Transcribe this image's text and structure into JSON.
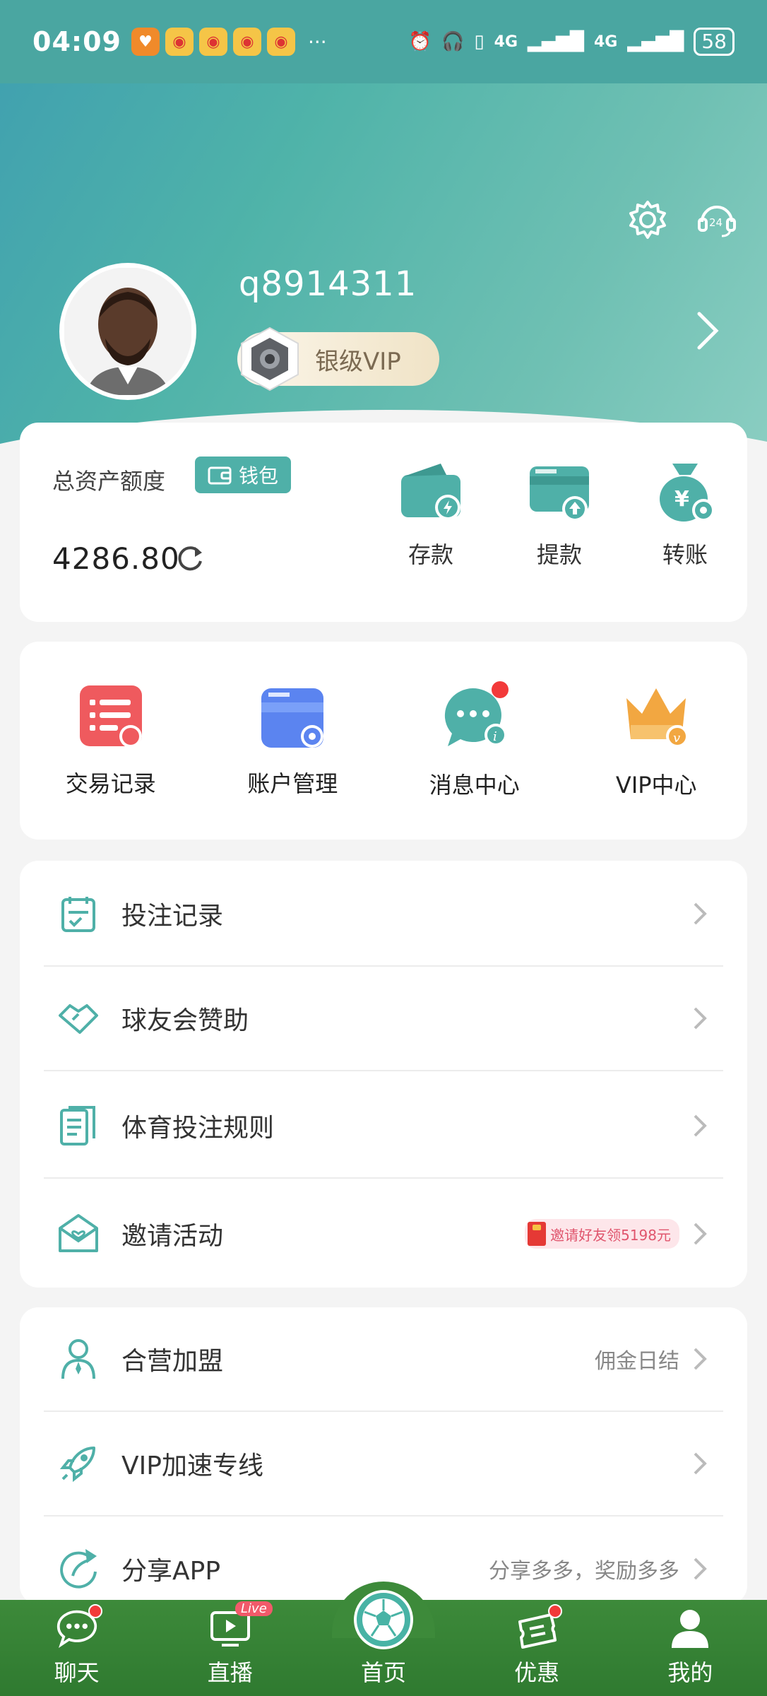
{
  "status_bar": {
    "time": "04:09",
    "more": "···",
    "network1": "4G",
    "network2": "4G",
    "battery": "58"
  },
  "profile": {
    "username": "q8914311",
    "vip_level": "银级VIP"
  },
  "assets": {
    "label": "总资产额度",
    "wallet_tag": "钱包",
    "amount": "4286.80",
    "actions": [
      {
        "label": "存款",
        "icon": "wallet-deposit-icon"
      },
      {
        "label": "提款",
        "icon": "card-withdraw-icon"
      },
      {
        "label": "转账",
        "icon": "money-bag-transfer-icon"
      }
    ]
  },
  "quick_menu": [
    {
      "label": "交易记录",
      "icon": "transaction-record-icon"
    },
    {
      "label": "账户管理",
      "icon": "account-management-icon"
    },
    {
      "label": "消息中心",
      "icon": "message-center-icon"
    },
    {
      "label": "VIP中心",
      "icon": "vip-crown-icon"
    }
  ],
  "list1": [
    {
      "label": "投注记录",
      "icon": "bet-record-icon",
      "right_text": ""
    },
    {
      "label": "球友会赞助",
      "icon": "sponsor-handshake-icon",
      "right_text": ""
    },
    {
      "label": "体育投注规则",
      "icon": "rules-document-icon",
      "right_text": ""
    },
    {
      "label": "邀请活动",
      "icon": "invite-envelope-icon",
      "right_text": "邀请好友领5198元"
    }
  ],
  "list2": [
    {
      "label": "合营加盟",
      "icon": "partner-person-icon",
      "right_text": "佣金日结"
    },
    {
      "label": "VIP加速专线",
      "icon": "rocket-icon",
      "right_text": ""
    },
    {
      "label": "分享APP",
      "icon": "share-arrow-icon",
      "right_text": "分享多多，奖励多多"
    }
  ],
  "bottom_nav": [
    {
      "label": "聊天",
      "icon": "chat-icon"
    },
    {
      "label": "直播",
      "icon": "live-tv-icon",
      "badge": "Live"
    },
    {
      "label": "首页",
      "icon": "soccer-ball-icon"
    },
    {
      "label": "优惠",
      "icon": "coupon-icon"
    },
    {
      "label": "我的",
      "icon": "user-icon"
    }
  ],
  "colors": {
    "accent": "#4fb0a8",
    "nav_bg": "#3d8a3a",
    "red_dot": "#f23a3a"
  }
}
